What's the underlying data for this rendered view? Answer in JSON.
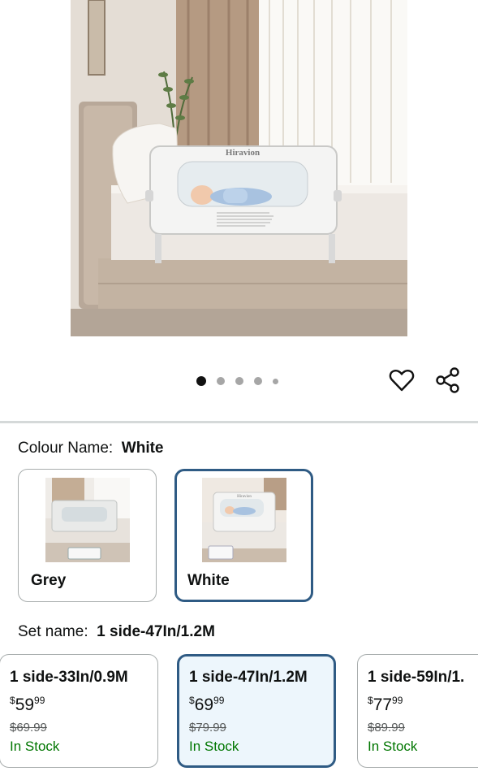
{
  "product_image": {
    "brand_text": "Hiravion",
    "carousel_count": 5,
    "carousel_active": 1
  },
  "actions": {
    "favorite_icon": "heart-icon",
    "share_icon": "share-icon"
  },
  "colour": {
    "label": "Colour Name:",
    "selected": "White",
    "options": [
      {
        "name": "Grey",
        "selected": false
      },
      {
        "name": "White",
        "selected": true
      }
    ]
  },
  "set": {
    "label": "Set name:",
    "selected": "1 side-47In/1.2M",
    "options": [
      {
        "title": "1 side-33In/0.9M",
        "currency": "$",
        "whole": "59",
        "cents": "99",
        "list_price": "$69.99",
        "stock": "In Stock",
        "selected": false
      },
      {
        "title": "1 side-47In/1.2M",
        "currency": "$",
        "whole": "69",
        "cents": "99",
        "list_price": "$79.99",
        "stock": "In Stock",
        "selected": true
      },
      {
        "title": "1 side-59In/1.",
        "currency": "$",
        "whole": "77",
        "cents": "99",
        "list_price": "$89.99",
        "stock": "In Stock",
        "selected": false
      }
    ]
  },
  "colors": {
    "selected_border": "#2f5b84",
    "selected_bg": "#edf6fc",
    "in_stock": "#007600"
  }
}
